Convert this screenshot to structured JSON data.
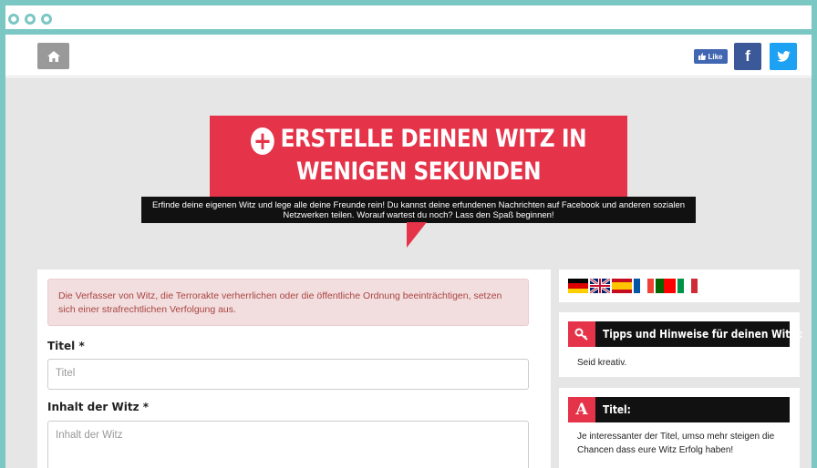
{
  "window": {
    "dots": [
      "window-dot-1",
      "window-dot-2",
      "window-dot-3"
    ]
  },
  "navbar": {
    "like_label": "Like",
    "facebook_glyph": "f"
  },
  "hero": {
    "title_line1": "ERSTELLE DEINEN WITZ IN",
    "title_line2": "WENIGEN SEKUNDEN",
    "subtitle": "Erfinde deine eigenen Witz und lege alle deine Freunde rein! Du kannst deine erfundenen Nachrichten auf Facebook und anderen sozialen Netzwerken teilen. Worauf wartest du noch? Lass den Spaß beginnen!"
  },
  "form": {
    "alert": "Die Verfasser von Witz, die Terrorakte verherrlichen oder die öffentliche Ordnung beeinträchtigen, setzen sich einer strafrechtlichen Verfolgung aus.",
    "title_label": "Titel *",
    "title_placeholder": "Titel",
    "content_label": "Inhalt der Witz *",
    "content_placeholder": "Inhalt der Witz"
  },
  "sidebar": {
    "flags": [
      "german-flag",
      "uk-flag",
      "spanish-flag",
      "french-flag",
      "portuguese-flag",
      "italian-flag"
    ],
    "tips_title": "Tipps und Hinweise für deinen Witz :",
    "tips_text": "Seid kreativ.",
    "title_box_letter": "A",
    "title_box_title": "Titel:",
    "title_box_text": "Je interessanter der Titel, umso mehr steigen die Chancen dass eure Witz Erfolg haben!"
  },
  "colors": {
    "accent": "#e5344a",
    "frame": "#7ac7c4",
    "facebook": "#3b5998",
    "twitter": "#1da1f2"
  }
}
